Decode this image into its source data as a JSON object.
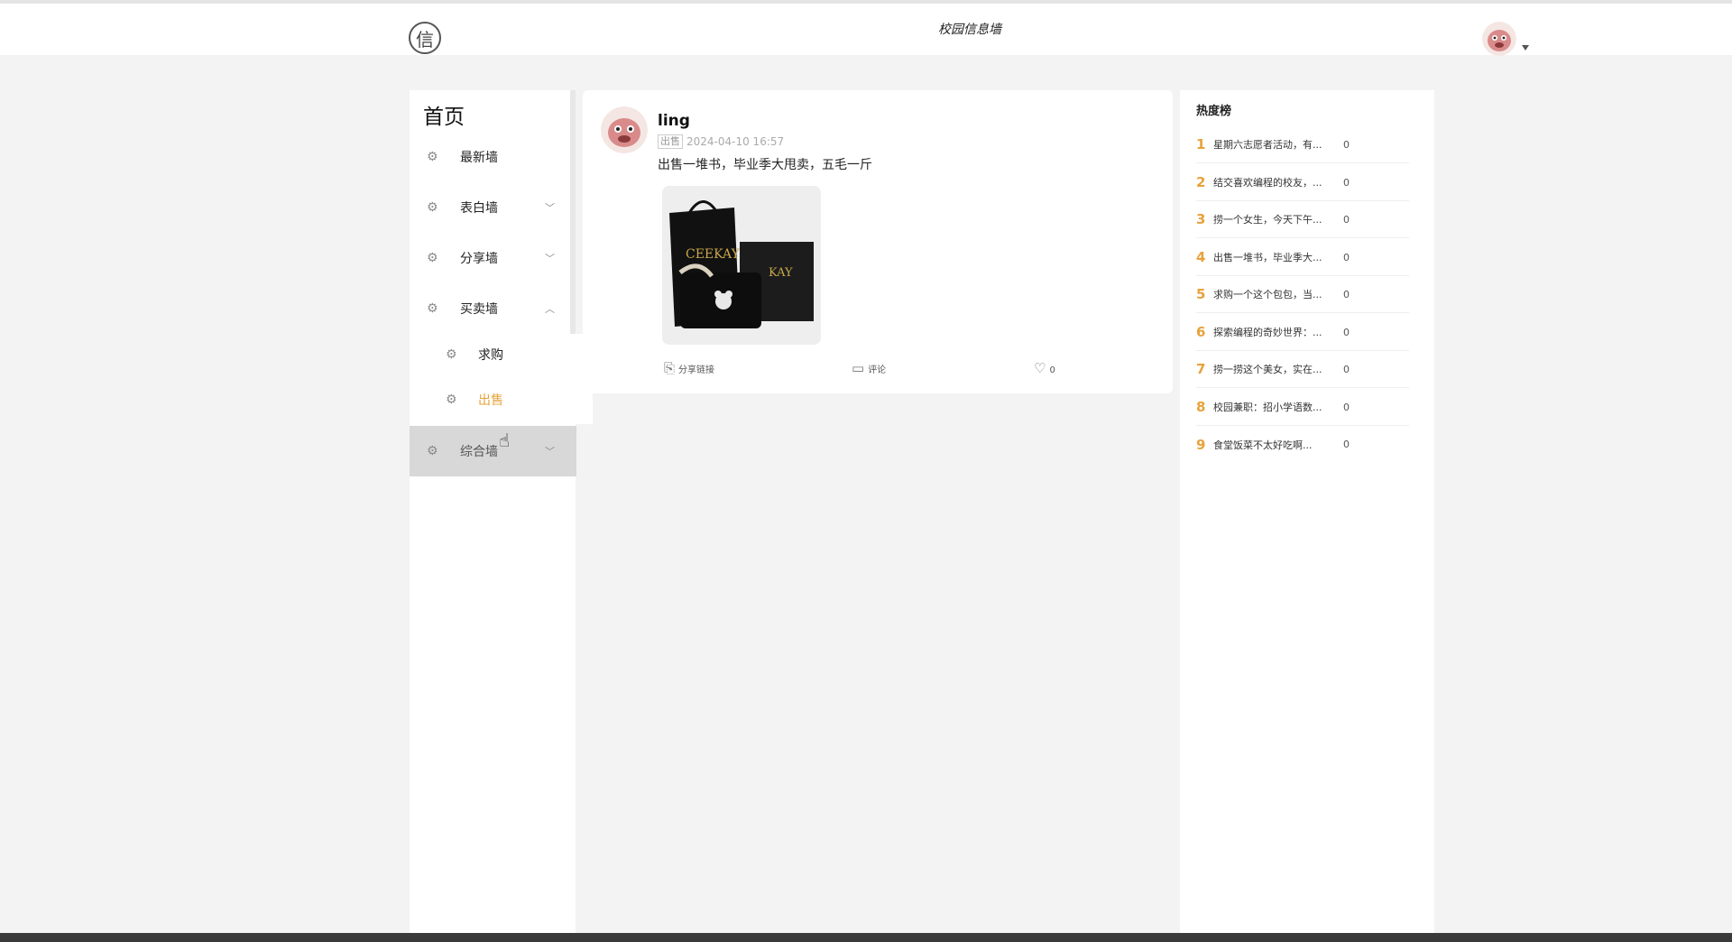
{
  "header": {
    "logo_glyph": "信",
    "site_title": "校园信息墙",
    "user_avatar": "avatar",
    "menu_icon": "caret-down-icon"
  },
  "sidebar": {
    "home_label": "首页",
    "items": [
      {
        "label": "最新墙",
        "icon": "gear-icon",
        "chevron": ""
      },
      {
        "label": "表白墙",
        "icon": "gear-icon",
        "chevron": "﹀"
      },
      {
        "label": "分享墙",
        "icon": "gear-icon",
        "chevron": "﹀"
      },
      {
        "label": "买卖墙",
        "icon": "gear-icon",
        "chevron": "︿"
      },
      {
        "label": "求购",
        "icon": "gear-icon",
        "chevron": ""
      },
      {
        "label": "出售",
        "icon": "gear-icon",
        "chevron": ""
      },
      {
        "label": "综合墙",
        "icon": "gear-icon",
        "chevron": "﹀"
      }
    ],
    "active_color": "#e6a33a"
  },
  "post": {
    "username": "ling",
    "tag": "出售",
    "time": "2024-04-10 16:57",
    "content": "出售一堆书，毕业季大甩卖，五毛一斤",
    "image_brand": "CEEKAY",
    "actions": {
      "share_label": "分享链接",
      "comment_label": "评论",
      "like_count": "0"
    }
  },
  "hot": {
    "title": "热度榜",
    "rank_color": "#e8a23a",
    "items": [
      {
        "rank": "1",
        "text": "星期六志愿者活动，有...",
        "count": "0"
      },
      {
        "rank": "2",
        "text": "结交喜欢编程的校友，...",
        "count": "0"
      },
      {
        "rank": "3",
        "text": "捞一个女生，今天下午...",
        "count": "0"
      },
      {
        "rank": "4",
        "text": "出售一堆书，毕业季大...",
        "count": "0"
      },
      {
        "rank": "5",
        "text": "求购一个这个包包，当...",
        "count": "0"
      },
      {
        "rank": "6",
        "text": "探索编程的奇妙世界：...",
        "count": "0"
      },
      {
        "rank": "7",
        "text": "捞一捞这个美女，实在...",
        "count": "0"
      },
      {
        "rank": "8",
        "text": "校园兼职：招小学语数...",
        "count": "0"
      },
      {
        "rank": "9",
        "text": "食堂饭菜不太好吃啊...",
        "count": "0"
      }
    ]
  }
}
